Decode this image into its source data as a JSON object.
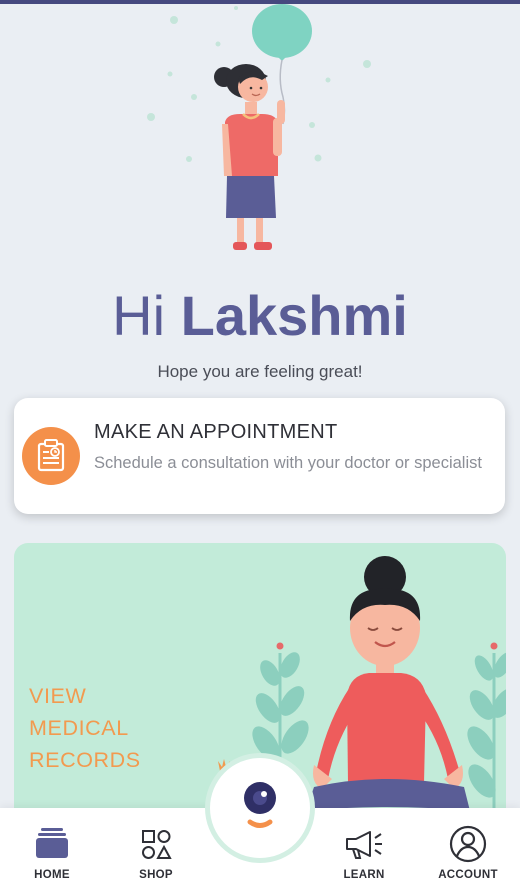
{
  "greeting": {
    "hi": "Hi",
    "name": "Lakshmi"
  },
  "subtitle": "Hope you are feeling great!",
  "appointment": {
    "title": "MAKE AN APPOINTMENT",
    "description": "Schedule a consultation with your doctor or specialist",
    "icon": "calendar-clock-icon"
  },
  "records": {
    "label": "VIEW MEDICAL RECORDS"
  },
  "nav": {
    "items": [
      {
        "label": "HOME",
        "icon": "home-icon"
      },
      {
        "label": "SHOP",
        "icon": "shapes-icon"
      },
      {
        "label": "LEARN",
        "icon": "megaphone-icon"
      },
      {
        "label": "ACCOUNT",
        "icon": "user-circle-icon"
      }
    ],
    "center_icon": "bot-face-icon"
  },
  "colors": {
    "primary": "#5a5d96",
    "accent_orange": "#f4904a",
    "records_bg": "#c2ebd9",
    "background": "#eaeef3",
    "top_bar": "#46497f"
  }
}
